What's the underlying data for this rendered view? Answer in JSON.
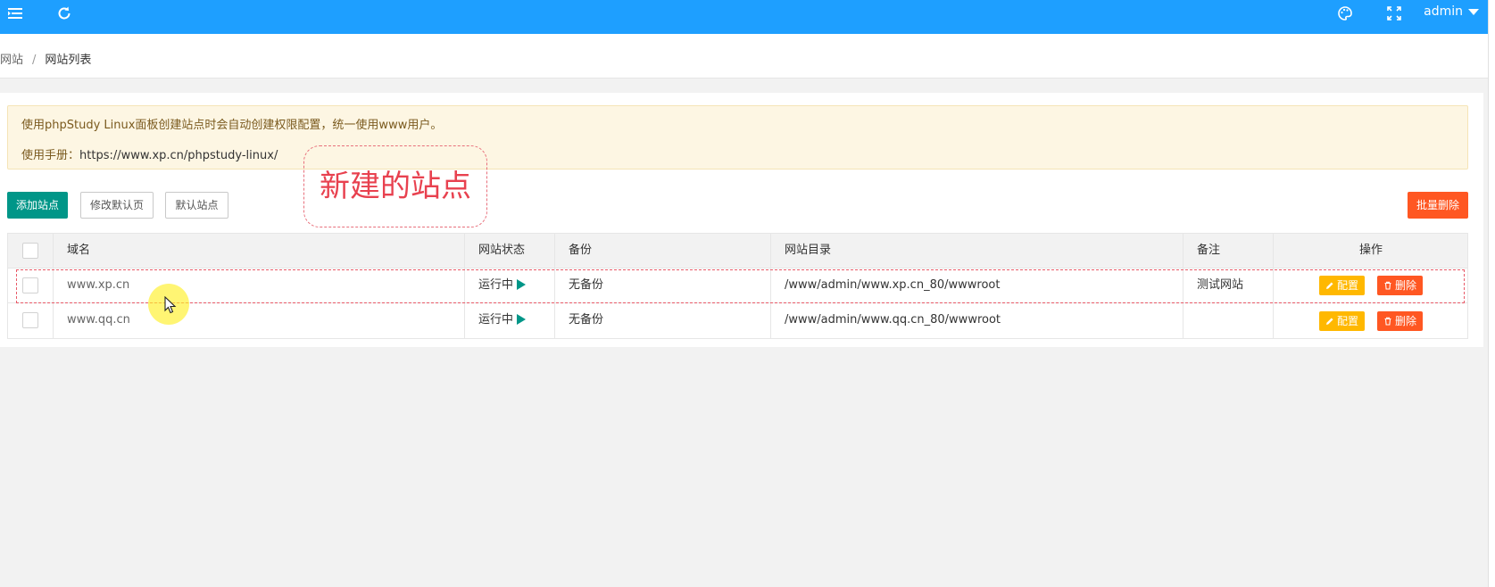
{
  "header": {
    "user": "admin",
    "icons": [
      "menu-icon",
      "refresh-icon",
      "palette-icon",
      "fullscreen-icon"
    ],
    "color": "#1e9fff"
  },
  "breadcrumb": {
    "parent": "网站",
    "separator": "/",
    "current": "网站列表"
  },
  "notice": {
    "line1": "使用phpStudy Linux面板创建站点时会自动创建权限配置，统一使用www用户。",
    "line2_label": "使用手册：",
    "line2_url": "https://www.xp.cn/phpstudy-linux/"
  },
  "toolbar": {
    "add_site": "添加站点",
    "edit_default_page": "修改默认页",
    "default_site": "默认站点",
    "batch_delete": "批量删除"
  },
  "annotation": {
    "callout_text": "新建的站点"
  },
  "table": {
    "columns": [
      "域名",
      "网站状态",
      "备份",
      "网站目录",
      "备注",
      "操作"
    ],
    "rows": [
      {
        "domain": "www.xp.cn",
        "status": "运行中",
        "backup": "无备份",
        "dir": "/www/admin/www.xp.cn_80/wwwroot",
        "note": "测试网站",
        "cfg": "配置",
        "del": "删除"
      },
      {
        "domain": "www.qq.cn",
        "status": "运行中",
        "backup": "无备份",
        "dir": "/www/admin/www.qq.cn_80/wwwroot",
        "note": "",
        "cfg": "配置",
        "del": "删除"
      }
    ]
  },
  "colors": {
    "primary": "#009688",
    "danger": "#ff5722",
    "warn": "#ffb800",
    "annotation": "#e8414f"
  }
}
